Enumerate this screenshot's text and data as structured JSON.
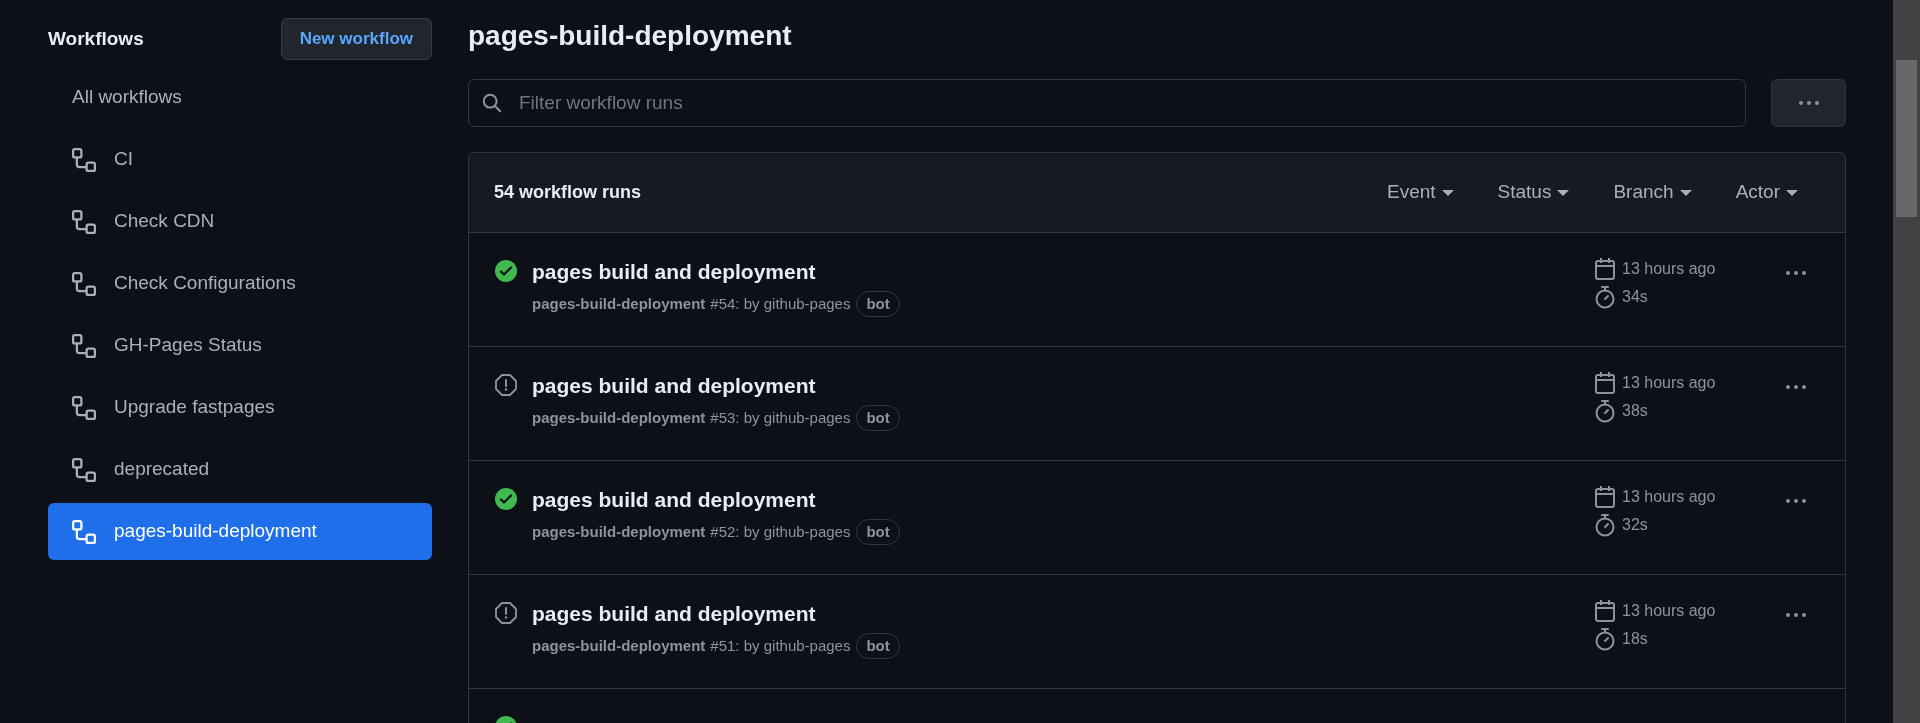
{
  "sidebar": {
    "title": "Workflows",
    "new_button": "New workflow",
    "items": [
      {
        "label": "All workflows",
        "kind": "all",
        "selected": false
      },
      {
        "label": "CI",
        "kind": "workflow",
        "selected": false
      },
      {
        "label": "Check CDN",
        "kind": "workflow",
        "selected": false
      },
      {
        "label": "Check Configurations",
        "kind": "workflow",
        "selected": false
      },
      {
        "label": "GH-Pages Status",
        "kind": "workflow",
        "selected": false
      },
      {
        "label": "Upgrade fastpages",
        "kind": "workflow",
        "selected": false
      },
      {
        "label": "deprecated",
        "kind": "workflow",
        "selected": false
      },
      {
        "label": "pages-build-deployment",
        "kind": "workflow",
        "selected": true
      }
    ]
  },
  "main": {
    "title": "pages-build-deployment",
    "search": {
      "placeholder": "Filter workflow runs"
    },
    "runs_header": {
      "count": "54 workflow runs",
      "filters": [
        "Event",
        "Status",
        "Branch",
        "Actor"
      ]
    },
    "runs": [
      {
        "kind": "success",
        "title": "pages build and deployment",
        "workflow": "pages-build-deployment",
        "number": "#54: by github-pages",
        "badge": "bot",
        "when": "13 hours ago",
        "duration": "34s"
      },
      {
        "kind": "failure",
        "title": "pages build and deployment",
        "workflow": "pages-build-deployment",
        "number": "#53: by github-pages",
        "badge": "bot",
        "when": "13 hours ago",
        "duration": "38s"
      },
      {
        "kind": "success",
        "title": "pages build and deployment",
        "workflow": "pages-build-deployment",
        "number": "#52: by github-pages",
        "badge": "bot",
        "when": "13 hours ago",
        "duration": "32s"
      },
      {
        "kind": "failure",
        "title": "pages build and deployment",
        "workflow": "pages-build-deployment",
        "number": "#51: by github-pages",
        "badge": "bot",
        "when": "13 hours ago",
        "duration": "18s"
      },
      {
        "kind": "success"
      }
    ]
  }
}
